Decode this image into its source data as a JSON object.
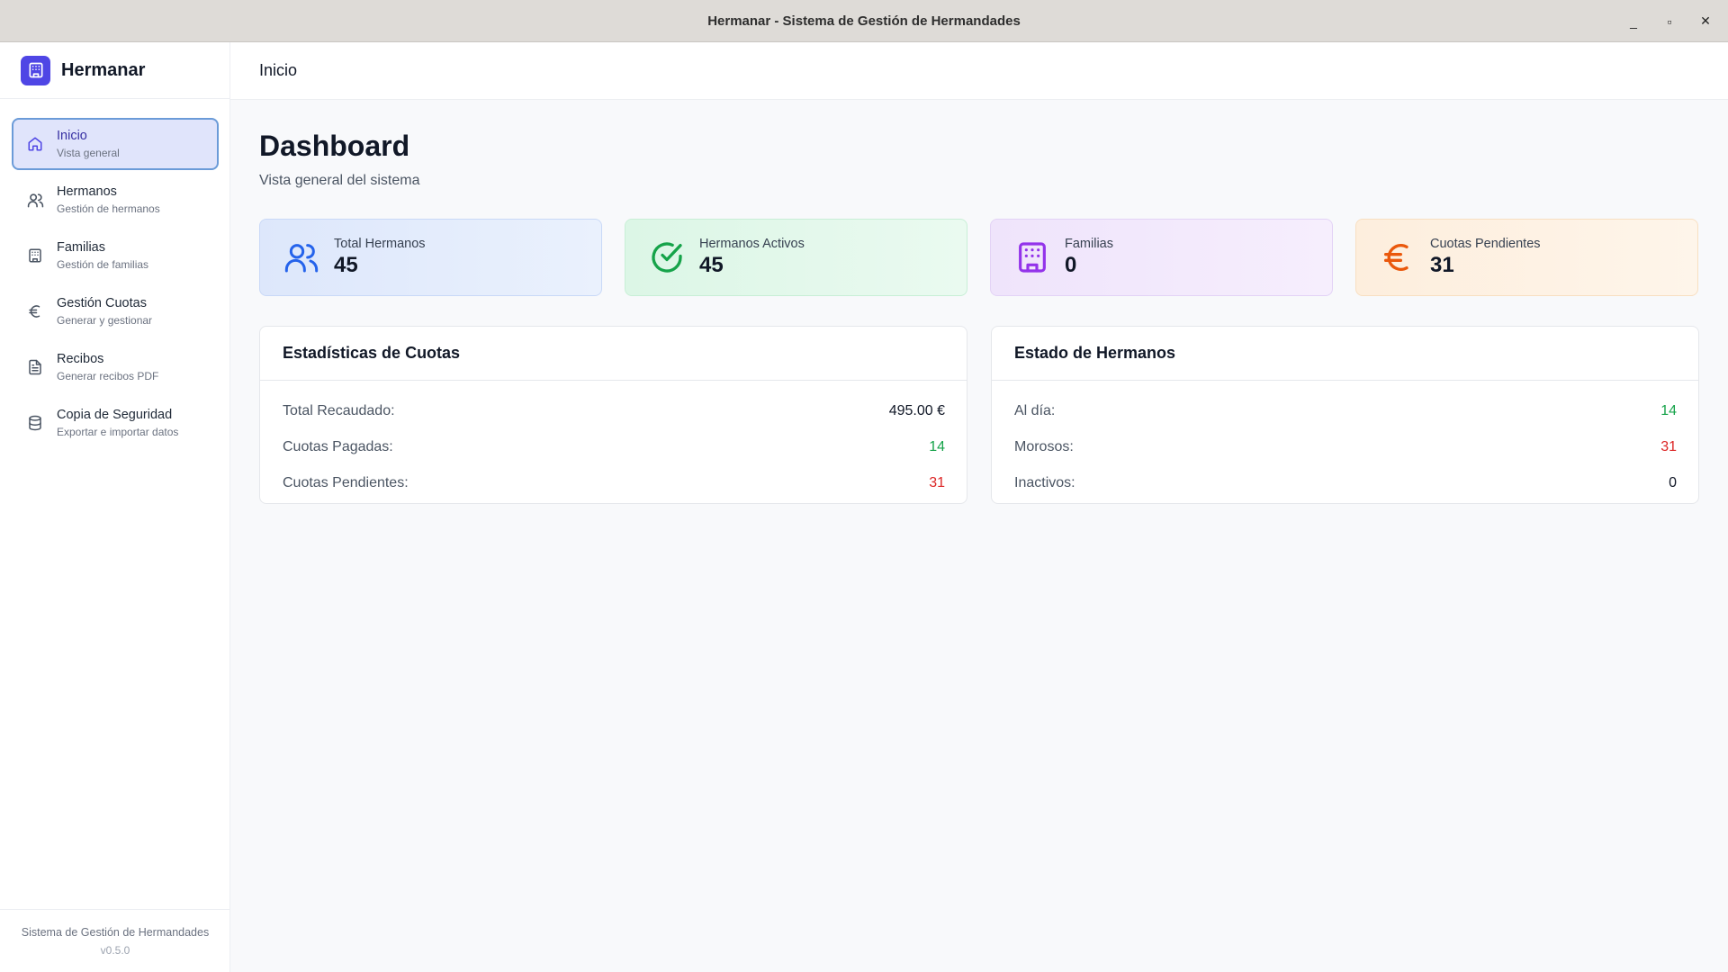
{
  "window": {
    "title": "Hermanar - Sistema de Gestión de Hermandades",
    "minimize": "_",
    "maximize": "▫",
    "close": "✕"
  },
  "sidebar": {
    "brand": "Hermanar",
    "items": [
      {
        "label": "Inicio",
        "sub": "Vista general",
        "icon": "home-icon",
        "active": true
      },
      {
        "label": "Hermanos",
        "sub": "Gestión de hermanos",
        "icon": "users-icon"
      },
      {
        "label": "Familias",
        "sub": "Gestión de familias",
        "icon": "building-icon"
      },
      {
        "label": "Gestión Cuotas",
        "sub": "Generar y gestionar",
        "icon": "euro-icon"
      },
      {
        "label": "Recibos",
        "sub": "Generar recibos PDF",
        "icon": "document-icon"
      },
      {
        "label": "Copia de Seguridad",
        "sub": "Exportar e importar datos",
        "icon": "database-icon"
      }
    ],
    "footer": {
      "line1": "Sistema de Gestión de Hermandades",
      "version": "v0.5.0"
    }
  },
  "header": {
    "breadcrumb": "Inicio"
  },
  "main": {
    "title": "Dashboard",
    "subtitle": "Vista general del sistema",
    "stats": [
      {
        "label": "Total Hermanos",
        "value": "45",
        "icon": "users-icon",
        "color": "#2563eb"
      },
      {
        "label": "Hermanos Activos",
        "value": "45",
        "icon": "check-circle-icon",
        "color": "#16a34a"
      },
      {
        "label": "Familias",
        "value": "0",
        "icon": "building-icon",
        "color": "#9333ea"
      },
      {
        "label": "Cuotas Pendientes",
        "value": "31",
        "icon": "euro-icon",
        "color": "#ea580c"
      }
    ],
    "cuotas_panel": {
      "title": "Estadísticas de Cuotas",
      "rows": [
        {
          "label": "Total Recaudado:",
          "value": "495.00 €"
        },
        {
          "label": "Cuotas Pagadas:",
          "value": "14"
        },
        {
          "label": "Cuotas Pendientes:",
          "value": "31"
        }
      ]
    },
    "hermanos_panel": {
      "title": "Estado de Hermanos",
      "rows": [
        {
          "label": "Al día:",
          "value": "14"
        },
        {
          "label": "Morosos:",
          "value": "31"
        },
        {
          "label": "Inactivos:",
          "value": "0"
        }
      ]
    }
  },
  "colors": {
    "accent": "#4f46e5",
    "success": "#16a34a",
    "danger": "#dc2626"
  }
}
